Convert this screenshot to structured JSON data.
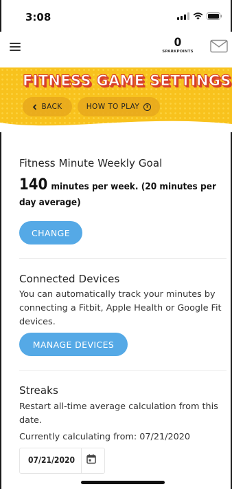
{
  "status_bar": {
    "time": "3:08"
  },
  "header": {
    "points_value": "0",
    "points_label": "SPARKPOINTS"
  },
  "banner": {
    "title": "FITNESS GAME SETTINGS",
    "back_label": "BACK",
    "how_to_play_label": "HOW TO PLAY"
  },
  "goal": {
    "title": "Fitness Minute Weekly Goal",
    "minutes": "140",
    "description": "minutes per week. (20 minutes per day average)",
    "change_label": "CHANGE"
  },
  "devices": {
    "title": "Connected Devices",
    "description": "You can automatically track your minutes by connecting a Fitbit, Apple Health or Google Fit devices.",
    "manage_label": "MANAGE DEVICES"
  },
  "streaks": {
    "title": "Streaks",
    "description": "Restart all-time average calculation from this date.",
    "calculating_text": "Currently calculating from: 07/21/2020",
    "date_value": "07/21/2020"
  },
  "colors": {
    "banner_yellow": "#f8c21d",
    "title_red": "#d8402b",
    "button_blue": "#55a9e6"
  },
  "icons": [
    "menu-icon",
    "mail-icon",
    "chevron-left-icon",
    "help-circle-icon",
    "calendar-icon",
    "signal-icon",
    "wifi-icon",
    "battery-icon"
  ]
}
